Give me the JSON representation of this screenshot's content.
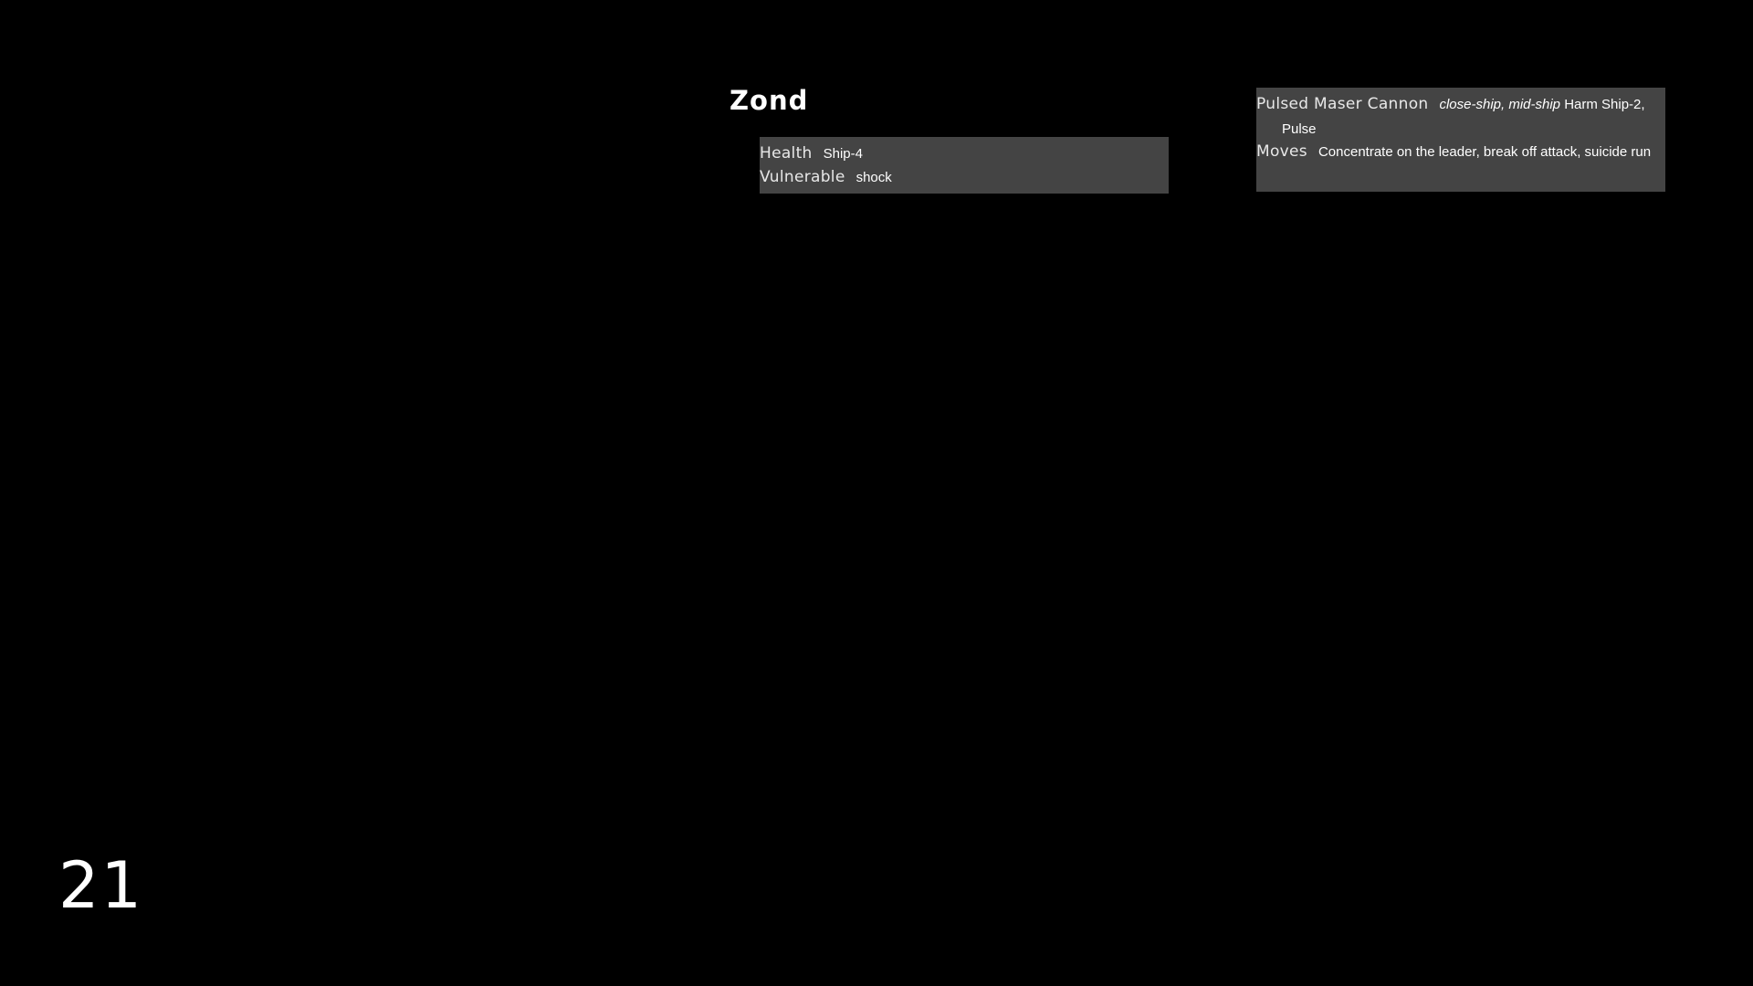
{
  "page": {
    "title": "Zond",
    "page_number": "21",
    "background_color": "#000000",
    "box_color": "#444444"
  },
  "stats": {
    "health_label": "Health",
    "health_value": "Ship-4",
    "vulnerable_label": "Vulnerable",
    "vulnerable_value": "shock"
  },
  "weapon": {
    "name": "Pulsed Maser Cannon",
    "ranges": "close-ship, mid-ship",
    "harm_text": "Harm",
    "harm_value": "Ship-2, Pulse"
  },
  "moves": {
    "label": "Moves",
    "value": "Concentrate on the leader, break off attack, suicide run"
  }
}
